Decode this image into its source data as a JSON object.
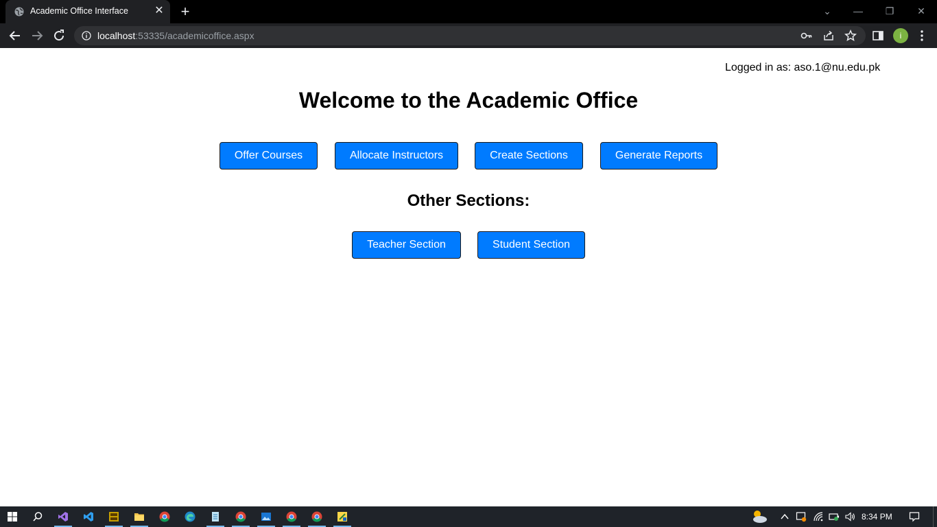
{
  "browser": {
    "tab_title": "Academic Office Interface",
    "url_host": "localhost",
    "url_rest": ":53335/academicoffice.aspx",
    "profile_initial": "i"
  },
  "page": {
    "logged_in_text": "Logged in as: aso.1@nu.edu.pk",
    "title": "Welcome to the Academic Office",
    "main_buttons": [
      {
        "label": "Offer Courses"
      },
      {
        "label": "Allocate Instructors"
      },
      {
        "label": "Create Sections"
      },
      {
        "label": "Generate Reports"
      }
    ],
    "other_heading": "Other Sections:",
    "other_buttons": [
      {
        "label": "Teacher Section"
      },
      {
        "label": "Student Section"
      }
    ],
    "button_color": "#007bff"
  },
  "taskbar": {
    "clock": "8:34 PM",
    "apps": [
      "start-icon",
      "search-icon",
      "visual-studio-icon",
      "vscode-icon",
      "dosbox-icon",
      "file-explorer-icon",
      "chrome-icon",
      "edge-icon",
      "notepad-icon",
      "chrome-icon",
      "photos-icon",
      "chrome-icon",
      "chrome-icon",
      "sticky-app-icon"
    ]
  }
}
